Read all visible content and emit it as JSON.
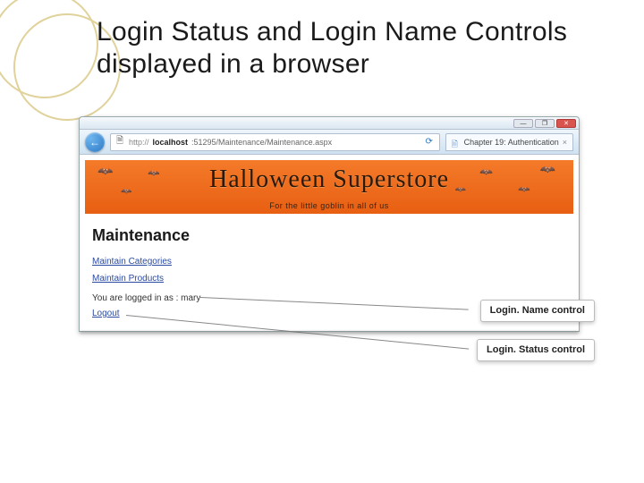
{
  "slide": {
    "title": "Login Status and Login Name Controls displayed in a browser"
  },
  "window": {
    "min": "—",
    "max": "❐",
    "close": "✕"
  },
  "nav": {
    "back_glyph": "←",
    "url_scheme_icon": "🗎",
    "url_prefix": "http://",
    "url_host": "localhost",
    "url_rest": ":51295/Maintenance/Maintenance.aspx",
    "refresh_glyph": "⟳",
    "tab_icon": "🗎",
    "tab_label": "Chapter 19: Authentication",
    "tab_close": "×"
  },
  "banner": {
    "title": "Halloween Superstore",
    "subtitle": "For the little goblin in all of us"
  },
  "page": {
    "heading": "Maintenance",
    "link_categories": "Maintain Categories",
    "link_products": "Maintain Products",
    "login_name_prefix": "You are logged in as : ",
    "login_name_user": "mary",
    "logout": "Logout"
  },
  "callouts": {
    "login_name": "Login. Name control",
    "login_status": "Login. Status control"
  }
}
